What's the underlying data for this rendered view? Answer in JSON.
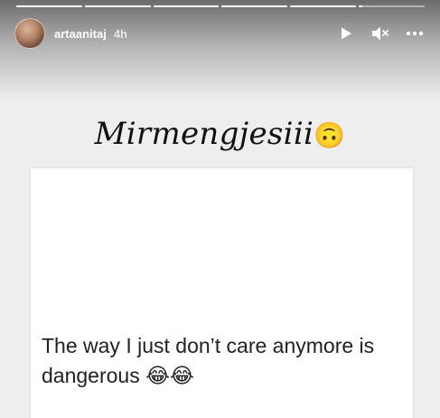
{
  "story": {
    "progress": [
      1,
      1,
      1,
      1,
      1,
      0.05
    ],
    "username": "artaanitaj",
    "time": "4h",
    "controls": [
      {
        "name": "play",
        "icon": "play-icon"
      },
      {
        "name": "mute",
        "icon": "muted-speaker-icon"
      },
      {
        "name": "more",
        "icon": "more-icon"
      }
    ],
    "caption_text": "Mirmengjesiii",
    "caption_emoji": "🙃",
    "post_text": "The way I just don’t care anymore is dangerous ",
    "post_emoji": "😂😂"
  },
  "colors": {
    "background": "#eeeeee",
    "card": "#ffffff",
    "caption": "#111111",
    "post_text": "#222222"
  }
}
